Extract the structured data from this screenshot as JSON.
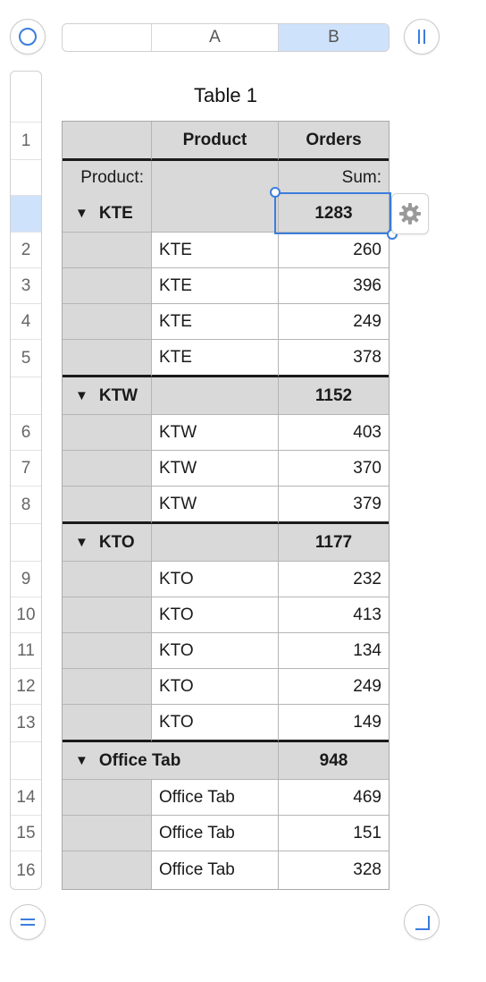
{
  "columns": {
    "a": "A",
    "b": "B"
  },
  "table_title": "Table 1",
  "header": {
    "col0": "",
    "product": "Product",
    "orders": "Orders"
  },
  "subheader": {
    "label": "Product:",
    "func": "Sum:"
  },
  "groups": [
    {
      "name": "KTE",
      "sum": "1283",
      "rows": [
        {
          "product": "KTE",
          "orders": "260"
        },
        {
          "product": "KTE",
          "orders": "396"
        },
        {
          "product": "KTE",
          "orders": "249"
        },
        {
          "product": "KTE",
          "orders": "378"
        }
      ]
    },
    {
      "name": "KTW",
      "sum": "1152",
      "rows": [
        {
          "product": "KTW",
          "orders": "403"
        },
        {
          "product": "KTW",
          "orders": "370"
        },
        {
          "product": "KTW",
          "orders": "379"
        }
      ]
    },
    {
      "name": "KTO",
      "sum": "1177",
      "rows": [
        {
          "product": "KTO",
          "orders": "232"
        },
        {
          "product": "KTO",
          "orders": "413"
        },
        {
          "product": "KTO",
          "orders": "134"
        },
        {
          "product": "KTO",
          "orders": "249"
        },
        {
          "product": "KTO",
          "orders": "149"
        }
      ]
    },
    {
      "name": "Office Tab",
      "sum": "948",
      "rows": [
        {
          "product": "Office Tab",
          "orders": "469"
        },
        {
          "product": "Office Tab",
          "orders": "151"
        },
        {
          "product": "Office Tab",
          "orders": "328"
        }
      ]
    }
  ],
  "row_numbers": [
    "1",
    "2",
    "3",
    "4",
    "5",
    "6",
    "7",
    "8",
    "9",
    "10",
    "11",
    "12",
    "13",
    "14",
    "15",
    "16"
  ],
  "disclosure_glyph": "▼",
  "colors": {
    "accent": "#3b7ddd",
    "selected_header": "#cfe2fb",
    "group_bg": "#d9d9d9"
  },
  "icons": {
    "table_select": "circle-icon",
    "column_handle": "pause-bars-icon",
    "row_handle": "equals-icon",
    "resize": "resize-corner-icon",
    "settings": "gear-icon"
  }
}
